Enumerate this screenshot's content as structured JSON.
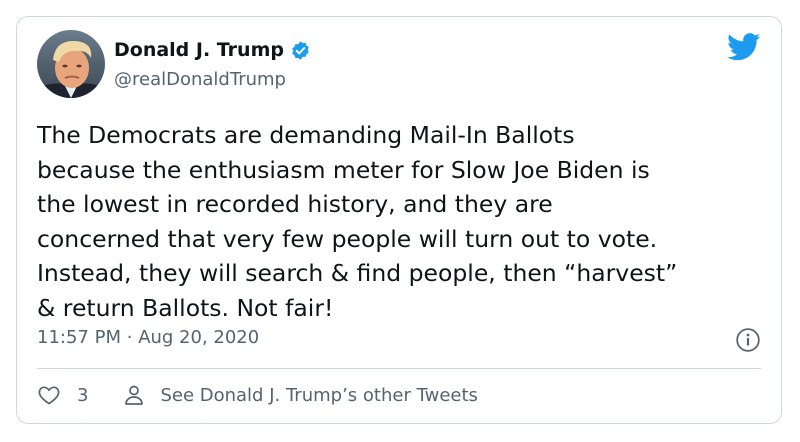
{
  "author": {
    "display_name": "Donald J. Trump",
    "handle": "@realDonaldTrump",
    "verified": true
  },
  "tweet": {
    "text_lines": [
      "The Democrats are demanding Mail-In Ballots",
      "because the enthusiasm meter for Slow Joe Biden is",
      "the lowest in recorded history, and they are",
      "concerned that very few people will turn out to vote.",
      "Instead, they will search & find people, then “harvest”",
      "& return Ballots. Not fair!"
    ],
    "time": "11:57 PM",
    "separator": "·",
    "date": "Aug 20, 2020"
  },
  "actions": {
    "like_count": "3",
    "profile_link_label": "See Donald J. Trump’s other Tweets"
  },
  "icons": {
    "verified": "verified-badge-icon",
    "logo": "twitter-bird-icon",
    "info": "info-icon",
    "like": "heart-icon",
    "profile": "person-icon"
  },
  "colors": {
    "text": "#0f1419",
    "muted": "#536471",
    "accent": "#1d9bf0",
    "border": "#cfd9de"
  }
}
